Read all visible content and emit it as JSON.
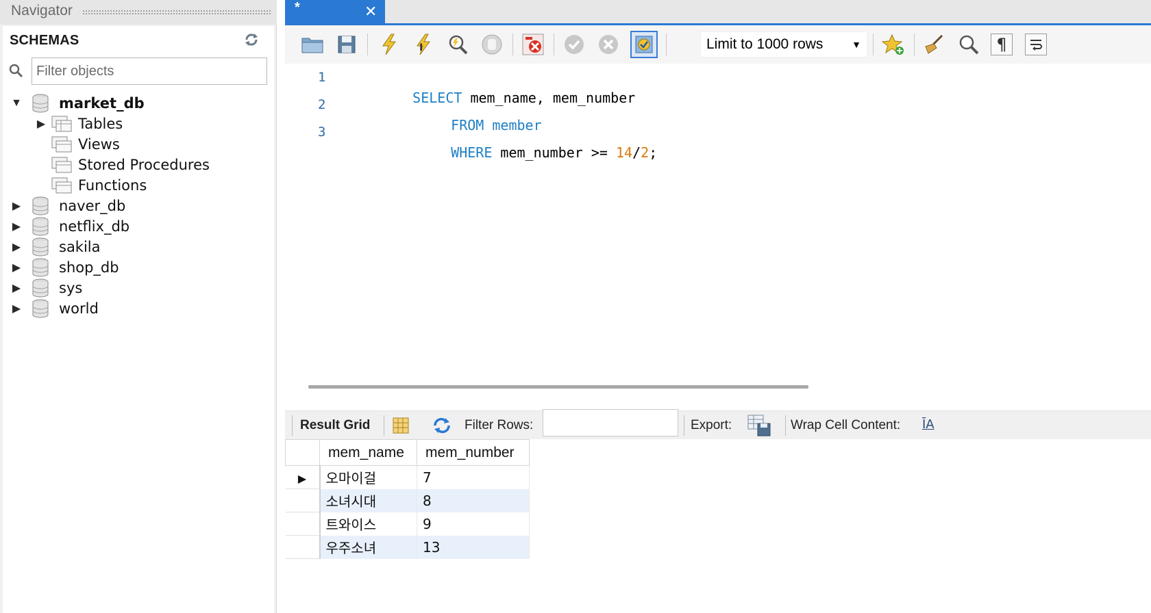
{
  "navigator": {
    "title": "Navigator",
    "section_label": "SCHEMAS",
    "filter_placeholder": "Filter objects",
    "expanded_schema": {
      "name": "market_db",
      "children": [
        "Tables",
        "Views",
        "Stored Procedures",
        "Functions"
      ]
    },
    "schemas": [
      "naver_db",
      "netflix_db",
      "sakila",
      "shop_db",
      "sys",
      "world"
    ]
  },
  "editor": {
    "tab_title": "*",
    "tab_close": "✕",
    "limit_label": "Limit to 1000 rows",
    "lines": [
      {
        "num": "1",
        "parts": [
          {
            "t": "SELECT",
            "k": "kw"
          },
          {
            "t": " mem_name, mem_number",
            "k": "id"
          }
        ]
      },
      {
        "num": "2",
        "parts": [
          {
            "t": "FROM",
            "k": "kw"
          },
          {
            "t": " member",
            "k": "kw"
          }
        ]
      },
      {
        "num": "3",
        "parts": [
          {
            "t": "WHERE",
            "k": "kw"
          },
          {
            "t": " mem_number >= ",
            "k": "id"
          },
          {
            "t": "14",
            "k": "num"
          },
          {
            "t": "/",
            "k": "id"
          },
          {
            "t": "2",
            "k": "num"
          },
          {
            "t": ";",
            "k": "id"
          }
        ]
      }
    ]
  },
  "result_toolbar": {
    "result_grid_label": "Result Grid",
    "filter_rows_label": "Filter Rows:",
    "export_label": "Export:",
    "wrap_label": "Wrap Cell Content:",
    "wrap_icon_text": "ĪA"
  },
  "result_grid": {
    "columns": [
      "mem_name",
      "mem_number"
    ],
    "rows": [
      [
        "오마이걸",
        "7"
      ],
      [
        "소녀시대",
        "8"
      ],
      [
        "트와이스",
        "9"
      ],
      [
        "우주소녀",
        "13"
      ]
    ]
  },
  "colors": {
    "accent": "#2a79d3",
    "keyword": "#1d7fc7",
    "number": "#d9780d",
    "row_alt": "#e8f1fb"
  },
  "icons": {
    "toolbar": [
      "open-folder-icon",
      "save-icon",
      "execute-icon",
      "execute-current-icon",
      "explain-icon",
      "stop-icon",
      "toggle-stop-on-error-icon",
      "commit-icon",
      "rollback-icon",
      "autocommit-icon",
      "add-snippet-icon",
      "beautify-icon",
      "find-icon",
      "invisible-chars-icon",
      "word-wrap-icon"
    ]
  }
}
